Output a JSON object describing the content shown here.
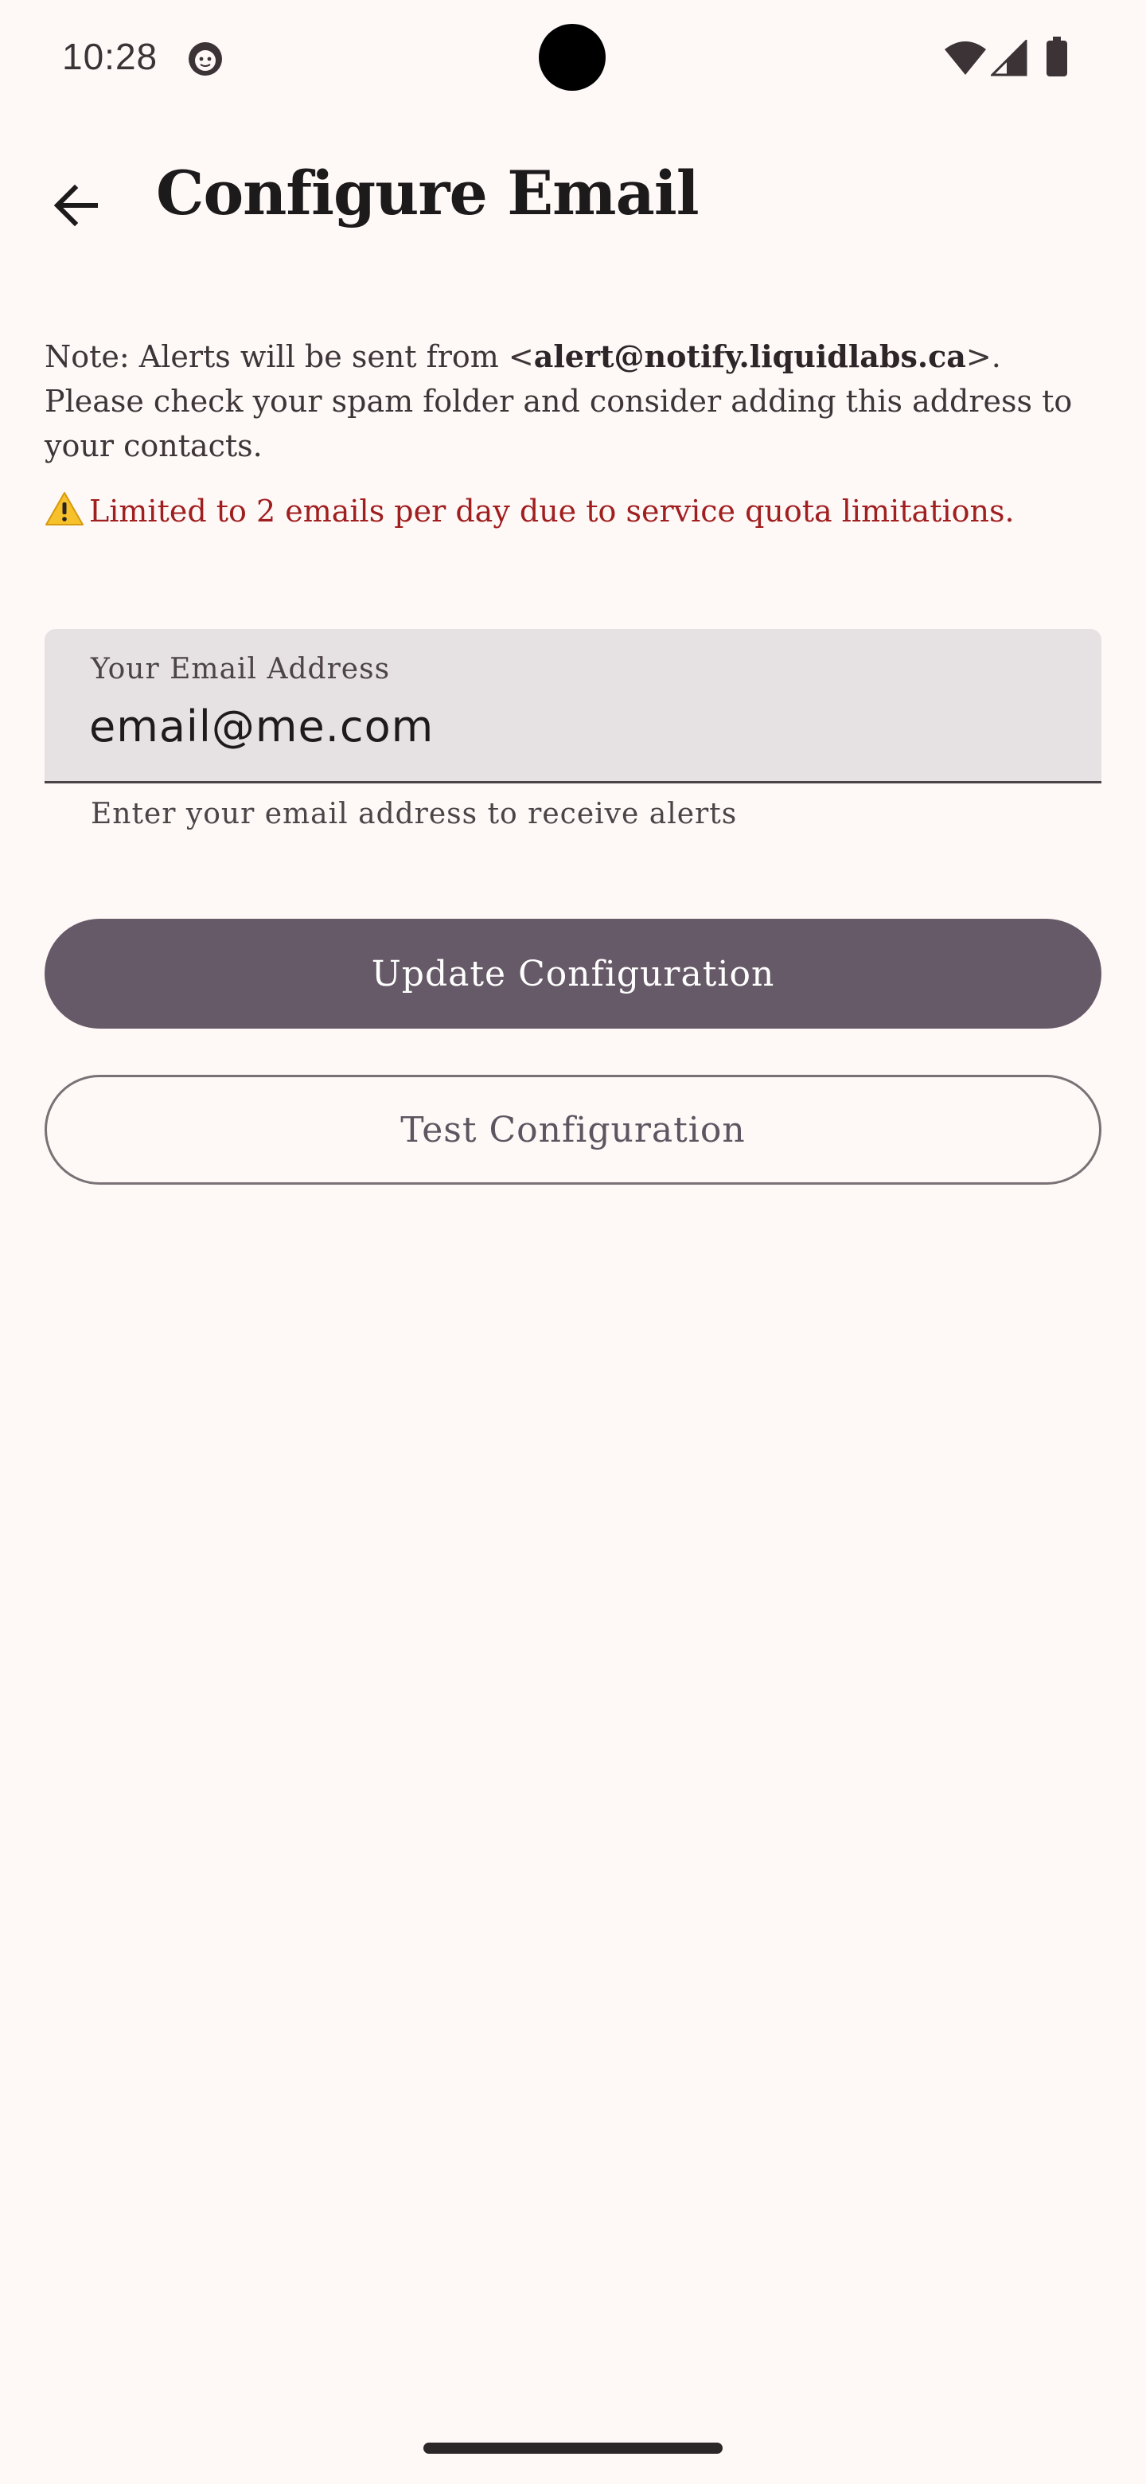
{
  "status_bar": {
    "time": "10:28",
    "icons": [
      "notification-face-icon",
      "wifi-icon",
      "cell-signal-icon",
      "battery-icon"
    ]
  },
  "top_bar": {
    "title": "Configure Email",
    "back_icon": "arrow-left-icon"
  },
  "note": {
    "prefix": "Note: Alerts will be sent from <",
    "sender_email": "alert@notify.liquidlabs.ca",
    "suffix": ">. Please check your spam folder and consider adding this address to your contacts."
  },
  "warning": {
    "icon": "warning-icon",
    "text": "Limited to 2 emails per day due to service quota limitations."
  },
  "email_field": {
    "label": "Your Email Address",
    "value": "email@me.com",
    "supporting_text": "Enter your email address to receive alerts"
  },
  "buttons": {
    "update_label": "Update Configuration",
    "test_label": "Test Configuration"
  },
  "colors": {
    "background": "#fef8f7",
    "primary_button": "#675a68",
    "warning": "#a01e1e",
    "field_background": "#e6e1e2"
  }
}
